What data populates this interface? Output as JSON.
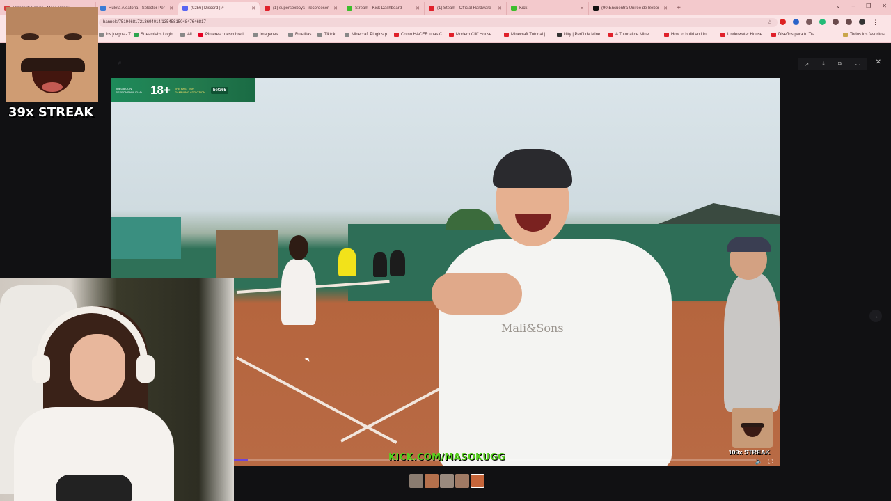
{
  "browser": {
    "tabs": [
      {
        "label": "Minecraft Server - Moss Resou",
        "color": "#d63c3c",
        "active": false
      },
      {
        "label": "Ruleta Aleatoria - Selector Per",
        "color": "#3a7bd5",
        "active": false
      },
      {
        "label": "(9256) Discord | #",
        "color": "#5865f2",
        "active": true
      },
      {
        "label": "(1) supersexboys - recordoser",
        "color": "#e0202a",
        "active": false
      },
      {
        "label": "Stream - Kick Dashboard",
        "color": "#3dbd2c",
        "active": false
      },
      {
        "label": "(1) Steam - Official Hardware",
        "color": "#e0202a",
        "active": false
      },
      {
        "label": "Kick",
        "color": "#3dbd2c",
        "active": false
      },
      {
        "label": "(90)Encuentra Unifee de Bebor",
        "color": "#111111",
        "active": false
      }
    ],
    "url": "hannels/751946817213694014/1354581504847646817",
    "bookmarks": [
      {
        "label": "los juegos - T...",
        "color": "#888"
      },
      {
        "label": "Streamlabs Login",
        "color": "#2ea44f"
      },
      {
        "label": "All",
        "color": "#888"
      },
      {
        "label": "Pinterest: descubre i...",
        "color": "#e60023"
      },
      {
        "label": "Imagenes",
        "color": "#888"
      },
      {
        "label": "Ruletitas",
        "color": "#888"
      },
      {
        "label": "Tiktok",
        "color": "#888"
      },
      {
        "label": "Minecraft Plugins p...",
        "color": "#888"
      },
      {
        "label": "Como HACER unas C...",
        "color": "#e0202a"
      },
      {
        "label": "Modern Cliff House...",
        "color": "#e0202a"
      },
      {
        "label": "Minecraft Tutorial |...",
        "color": "#e0202a"
      },
      {
        "label": "kitty | Perfil de Mine...",
        "color": "#333"
      },
      {
        "label": "A Tutorial de Mine...",
        "color": "#e0202a"
      },
      {
        "label": "How to build an Un...",
        "color": "#e0202a"
      },
      {
        "label": "Underwater House...",
        "color": "#e0202a"
      },
      {
        "label": "Diseños para tu Tra...",
        "color": "#e0202a"
      }
    ],
    "all_favorites_label": "Todos los favoritos"
  },
  "overlay": {
    "streak_text": "39x STREAK",
    "mini_streak_text": "109x STREAK",
    "kick_url": "KICK.COM/MASOKUGG"
  },
  "video": {
    "promo": {
      "age": "18+",
      "left_text": "JUEGA CON RESPONSABILIDAD",
      "tag_text": "THE FAST TOP GAMBLING ADDICTION",
      "brand": "bet365"
    },
    "shirt_text": "Mali&Sons",
    "progress_fraction": 0.0267
  },
  "icons": {
    "prev": "←",
    "next": "→",
    "close": "✕",
    "volume": "🔈",
    "fullscreen": "⛶"
  }
}
